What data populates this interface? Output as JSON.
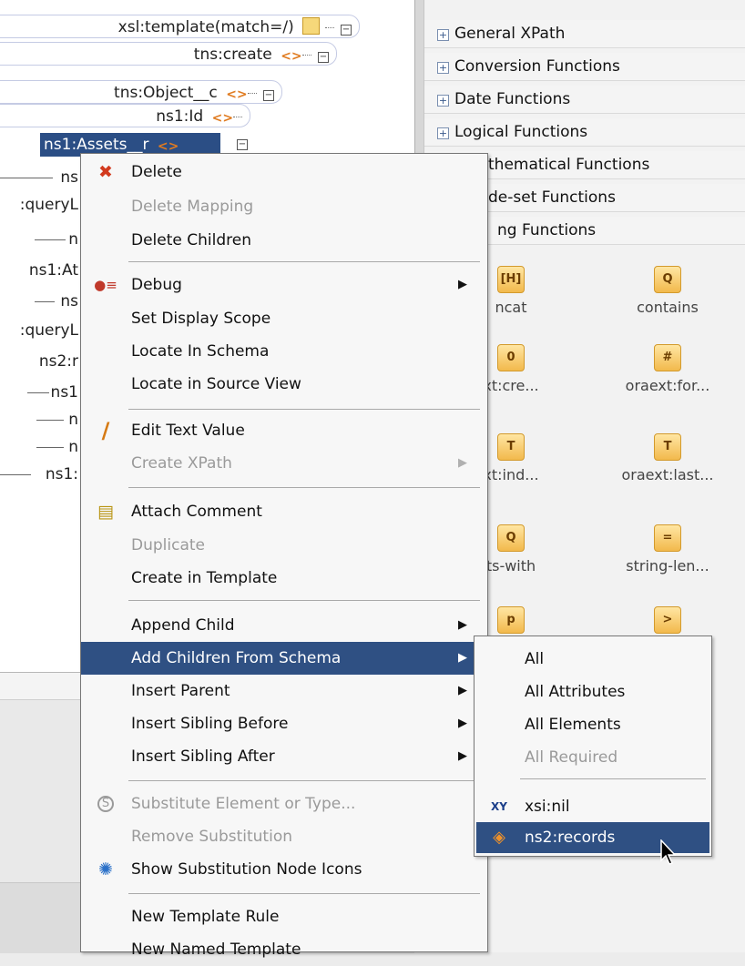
{
  "tree": {
    "nodes": [
      {
        "label": "xsl:template(match=/)"
      },
      {
        "label": "tns:create"
      },
      {
        "label": "tns:Object__c"
      },
      {
        "label": "ns1:Id"
      },
      {
        "label": "ns1:Assets__r"
      }
    ],
    "clipped": [
      "ns",
      ":queryL",
      "n",
      "ns1:At",
      "ns",
      ":queryL",
      "ns2:r",
      "ns1",
      "n",
      "n",
      "ns1:"
    ]
  },
  "functions_panel": {
    "categories": [
      "General XPath",
      "Conversion Functions",
      "Date Functions",
      "Logical Functions",
      "thematical Functions",
      "de-set Functions",
      "ng Functions"
    ],
    "items": [
      {
        "label": "ncat",
        "icon": "concat-icon",
        "glyph": "[H]"
      },
      {
        "label": "contains",
        "icon": "contains-icon",
        "glyph": "Q"
      },
      {
        "label": "xt:cre...",
        "icon": "create-icon",
        "glyph": "0"
      },
      {
        "label": "oraext:for...",
        "icon": "for-icon",
        "glyph": "#"
      },
      {
        "label": "xt:ind...",
        "icon": "index-icon",
        "glyph": "T"
      },
      {
        "label": "oraext:last...",
        "icon": "last-index-icon",
        "glyph": "T"
      },
      {
        "label": "ts-with",
        "icon": "starts-with-icon",
        "glyph": "Q"
      },
      {
        "label": "string-len...",
        "icon": "string-length-icon",
        "glyph": "="
      },
      {
        "label": "",
        "icon": "function-icon",
        "glyph": "p"
      },
      {
        "label": "",
        "icon": "function-icon",
        "glyph": ">"
      }
    ]
  },
  "context_menu": {
    "items": [
      {
        "label": "Delete",
        "icon": "delete-icon",
        "glyph": "✖",
        "color": "#d23a1e",
        "enabled": true
      },
      {
        "label": "Delete Mapping",
        "enabled": false
      },
      {
        "label": "Delete Children",
        "enabled": true
      },
      {
        "label": "Debug",
        "icon": "debug-icon",
        "glyph": "●≡",
        "color": "#c0392b",
        "enabled": true,
        "submenu": true
      },
      {
        "label": "Set Display Scope",
        "enabled": true
      },
      {
        "label": "Locate In Schema",
        "enabled": true
      },
      {
        "label": "Locate in Source View",
        "enabled": true
      },
      {
        "label": "Edit Text Value",
        "icon": "pencil-icon",
        "glyph": "/",
        "color": "#d67a14",
        "enabled": true
      },
      {
        "label": "Create XPath",
        "enabled": false,
        "submenu": true
      },
      {
        "label": "Attach Comment",
        "icon": "comment-icon",
        "glyph": "▤",
        "color": "#b89412",
        "enabled": true
      },
      {
        "label": "Duplicate",
        "enabled": false
      },
      {
        "label": "Create in Template",
        "enabled": true
      },
      {
        "label": "Append Child",
        "enabled": true,
        "submenu": true
      },
      {
        "label": "Add Children From Schema",
        "enabled": true,
        "submenu": true,
        "highlighted": true
      },
      {
        "label": "Insert Parent",
        "enabled": true,
        "submenu": true
      },
      {
        "label": "Insert Sibling Before",
        "enabled": true,
        "submenu": true
      },
      {
        "label": "Insert Sibling After",
        "enabled": true,
        "submenu": true
      },
      {
        "label": "Substitute Element or Type...",
        "icon": "substitute-icon",
        "glyph": "S",
        "color": "#9a9a9a",
        "enabled": false
      },
      {
        "label": "Remove Substitution",
        "enabled": false
      },
      {
        "label": "Show Substitution Node Icons",
        "icon": "substitution-node-icon",
        "glyph": "✺",
        "color": "#2a70c8",
        "enabled": true
      },
      {
        "label": "New Template Rule",
        "enabled": true
      },
      {
        "label": "New Named Template",
        "enabled": true
      }
    ]
  },
  "submenu": {
    "items": [
      {
        "label": "All",
        "enabled": true
      },
      {
        "label": "All Attributes",
        "enabled": true
      },
      {
        "label": "All Elements",
        "enabled": true
      },
      {
        "label": "All Required",
        "enabled": false
      },
      {
        "label": "xsi:nil",
        "icon": "xy-attribute-icon",
        "glyph": "XY",
        "enabled": true
      },
      {
        "label": "ns2:records",
        "icon": "element-icon",
        "glyph": "◈",
        "enabled": true,
        "highlighted": true
      }
    ]
  },
  "colors": {
    "highlight": "#2f5083",
    "selected_node": "#2b4e85",
    "disabled_text": "#9a9a9a"
  }
}
